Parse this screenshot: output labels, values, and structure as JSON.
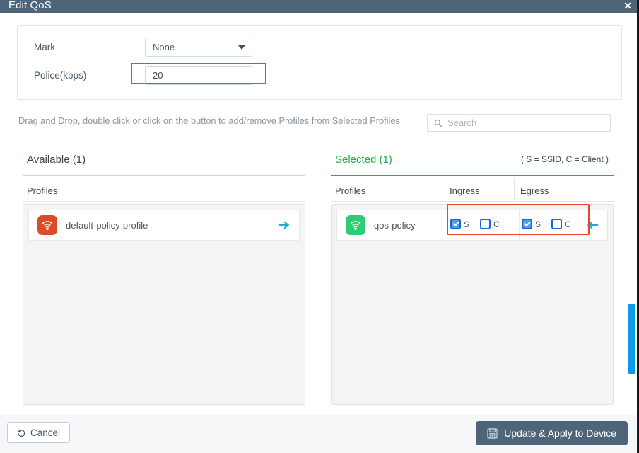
{
  "dialog": {
    "title": "Edit QoS",
    "close_label": "✕",
    "clipped_text": "··· ··· ·· ···· ··"
  },
  "form": {
    "mark": {
      "label": "Mark",
      "value": "None"
    },
    "police": {
      "label": "Police(kbps)",
      "value": "20"
    }
  },
  "helper": {
    "text": "Drag and Drop, double click or click on the button to add/remove Profiles from Selected Profiles"
  },
  "search": {
    "placeholder": "Search",
    "value": "",
    "icon": "search-icon"
  },
  "panels": {
    "hint": "( S = SSID, C = Client )",
    "available": {
      "tab_label": "Available (1)",
      "column_profiles": "Profiles",
      "rows": [
        {
          "name": "default-policy-profile",
          "icon": "wifi-icon",
          "icon_color": "#dd4a26",
          "action_icon": "arrow-right-icon",
          "action_color": "#1aaae5"
        }
      ]
    },
    "selected": {
      "tab_label": "Selected (1)",
      "accent_color": "#21b14c",
      "column_profiles": "Profiles",
      "column_ingress": "Ingress",
      "column_egress": "Egress",
      "rows": [
        {
          "name": "qos-policy",
          "icon": "wifi-icon",
          "icon_color": "#2ecc71",
          "action_icon": "arrow-left-icon",
          "action_color": "#1aaae5",
          "ingress": {
            "ssid_label": "S",
            "ssid_checked": true,
            "client_label": "C",
            "client_checked": false
          },
          "egress": {
            "ssid_label": "S",
            "ssid_checked": true,
            "client_label": "C",
            "client_checked": false
          }
        }
      ]
    }
  },
  "footer": {
    "cancel_label": "Cancel",
    "cancel_icon": "undo-arrow-icon",
    "apply_label": "Update & Apply to Device",
    "apply_icon": "save-floppy-icon"
  },
  "highlights": {
    "accent_color": "#ef4423",
    "police_field": "police-field-highlight",
    "checkbox_group": "checkbox-group-highlight"
  },
  "scrollbar": {
    "thumb_color": "#0d9ae8"
  }
}
